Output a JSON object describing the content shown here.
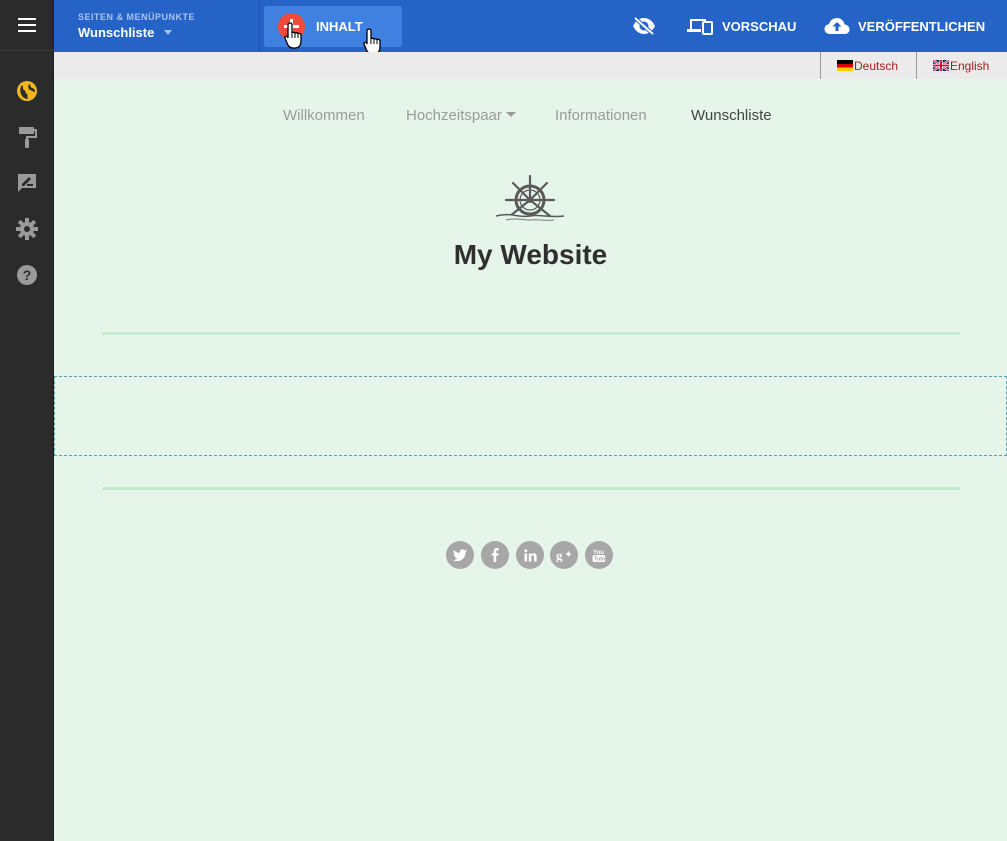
{
  "topbar": {
    "page_select_kicker": "SEITEN & MENÜPUNKTE",
    "page_select_current": "Wunschliste",
    "content_button": "INHALT",
    "preview_button": "VORSCHAU",
    "publish_button": "VERÖFFENTLICHEN"
  },
  "sidebar": {
    "items": [
      {
        "icon": "globe-icon"
      },
      {
        "icon": "paint-roller-icon"
      },
      {
        "icon": "edit-note-icon"
      },
      {
        "icon": "gear-icon"
      },
      {
        "icon": "help-icon"
      }
    ]
  },
  "languages": [
    {
      "label": "Deutsch",
      "flag": "de-flag-icon"
    },
    {
      "label": "English",
      "flag": "uk-flag-icon"
    }
  ],
  "nav": {
    "items": [
      "Willkommen",
      "Hochzeitspaar",
      "Informationen",
      "Wunschliste"
    ],
    "active": "Wunschliste"
  },
  "site": {
    "title": "My Website"
  },
  "social": [
    "twitter-icon",
    "facebook-icon",
    "linkedin-icon",
    "google-plus-icon",
    "youtube-icon"
  ],
  "colors": {
    "topbar": "#2563c7",
    "sidebar": "#2b2b2b",
    "canvas": "#e6f5ea",
    "accent_globe": "#f2b61d",
    "plus_button": "#ef4a3a"
  }
}
